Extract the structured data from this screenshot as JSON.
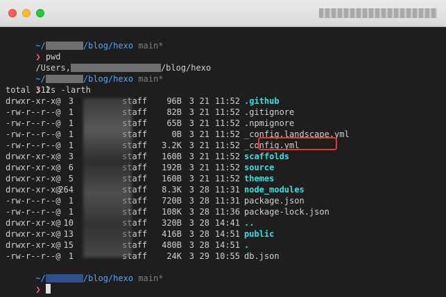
{
  "window": {
    "title_redacted": true
  },
  "prompts": {
    "p1": {
      "path_prefix": "~/",
      "path_suffix": "/blog/hexo",
      "branch": "main*"
    },
    "p2": {
      "path_prefix": "~/",
      "path_suffix": "/blog/hexo",
      "branch": "main*"
    },
    "p3": {
      "path_prefix": "~/",
      "path_suffix": "/blog/hexo",
      "branch": "main*"
    },
    "symbol": "❯"
  },
  "commands": {
    "pwd": "pwd",
    "ls": "ls -larth"
  },
  "pwd_output": {
    "prefix": "/Users,",
    "suffix": "/blog/hexo"
  },
  "total": "total 312",
  "ls_rows": [
    {
      "perm": "drwxr-xr-x@",
      "links": "3",
      "group": "staff",
      "size": "96B",
      "month": "3",
      "day": "21",
      "time": "11:52",
      "name": "github",
      "display": ".github",
      "dir": true
    },
    {
      "perm": "-rw-r--r--@",
      "links": "1",
      "group": "staff",
      "size": "82B",
      "month": "3",
      "day": "21",
      "time": "11:52",
      "name": "gitignore",
      "display": ".gitignore",
      "dir": false
    },
    {
      "perm": "-rw-r--r--@",
      "links": "1",
      "group": "staff",
      "size": "65B",
      "month": "3",
      "day": "21",
      "time": "11:52",
      "name": "npmignore",
      "display": ".npmignore",
      "dir": false
    },
    {
      "perm": "-rw-r--r--@",
      "links": "1",
      "group": "staff",
      "size": "0B",
      "month": "3",
      "day": "21",
      "time": "11:52",
      "name": "config.landscape",
      "display": "_config.landscape.yml",
      "dir": false
    },
    {
      "perm": "-rw-r--r--@",
      "links": "1",
      "group": "staff",
      "size": "3.2K",
      "month": "3",
      "day": "21",
      "time": "11:52",
      "name": "config",
      "display": "_config.yml",
      "dir": false
    },
    {
      "perm": "drwxr-xr-x@",
      "links": "3",
      "group": "staff",
      "size": "160B",
      "month": "3",
      "day": "21",
      "time": "11:52",
      "name": "scaffolds",
      "display": "scaffolds",
      "dir": true
    },
    {
      "perm": "drwxr-xr-x@",
      "links": "6",
      "group": "staff",
      "size": "192B",
      "month": "3",
      "day": "21",
      "time": "11:52",
      "name": "source",
      "display": "source",
      "dir": true
    },
    {
      "perm": "drwxr-xr-x@",
      "links": "5",
      "group": "staff",
      "size": "160B",
      "month": "3",
      "day": "21",
      "time": "11:52",
      "name": "themes",
      "display": "themes",
      "dir": true
    },
    {
      "perm": "drwxr-xr-x@",
      "links": "264",
      "group": "staff",
      "size": "8.3K",
      "month": "3",
      "day": "28",
      "time": "11:31",
      "name": "node-modules",
      "display": "node_modules",
      "dir": true
    },
    {
      "perm": "-rw-r--r--@",
      "links": "1",
      "group": "staff",
      "size": "720B",
      "month": "3",
      "day": "28",
      "time": "11:31",
      "name": "package",
      "display": "package.json",
      "dir": false
    },
    {
      "perm": "-rw-r--r--@",
      "links": "1",
      "group": "staff",
      "size": "108K",
      "month": "3",
      "day": "28",
      "time": "11:36",
      "name": "package-lock",
      "display": "package-lock.json",
      "dir": false
    },
    {
      "perm": "drwxr-xr-x@",
      "links": "10",
      "group": "staff",
      "size": "320B",
      "month": "3",
      "day": "28",
      "time": "14:41",
      "name": "parent",
      "display": "..",
      "dir": true
    },
    {
      "perm": "drwxr-xr-x@",
      "links": "13",
      "group": "staff",
      "size": "416B",
      "month": "3",
      "day": "28",
      "time": "14:51",
      "name": "public",
      "display": "public",
      "dir": true
    },
    {
      "perm": "drwxr-xr-x@",
      "links": "15",
      "group": "staff",
      "size": "480B",
      "month": "3",
      "day": "28",
      "time": "14:51",
      "name": "current",
      "display": ".",
      "dir": true
    },
    {
      "perm": "-rw-r--r--@",
      "links": "1",
      "group": "staff",
      "size": "24K",
      "month": "3",
      "day": "29",
      "time": "10:55",
      "name": "db",
      "display": "db.json",
      "dir": false
    }
  ],
  "highlighted_file": "_config.yml",
  "colors": {
    "dir": "#33e0e0",
    "prompt_path": "#5aa1ff",
    "prompt_symbol": "#ff5c8a",
    "highlight": "#e53935",
    "background": "#1e1e1e"
  }
}
